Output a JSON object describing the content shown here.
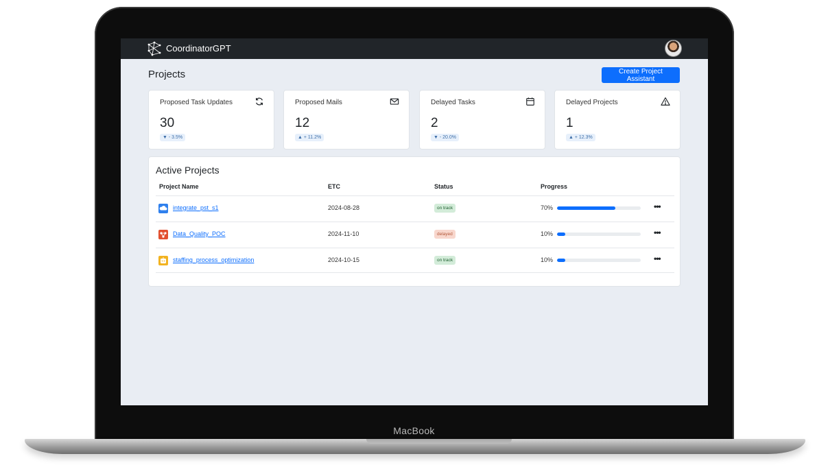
{
  "device": {
    "brand": "MacBook"
  },
  "navbar": {
    "app_title": "CoordinatorGPT"
  },
  "header": {
    "title": "Projects",
    "create_button": "Create Project Assistant"
  },
  "stats": [
    {
      "label": "Proposed Task Updates",
      "value": "30",
      "change": "▼ - 3.5%",
      "icon": "refresh-icon"
    },
    {
      "label": "Proposed Mails",
      "value": "12",
      "change": "▲ + 11.2%",
      "icon": "envelope-icon"
    },
    {
      "label": "Delayed Tasks",
      "value": "2",
      "change": "▼ - 20.0%",
      "icon": "calendar-icon"
    },
    {
      "label": "Delayed Projects",
      "value": "1",
      "change": "▲ + 12.3%",
      "icon": "warning-icon"
    }
  ],
  "active_projects": {
    "title": "Active Projects",
    "columns": [
      "Project Name",
      "ETC",
      "Status",
      "Progress"
    ],
    "rows": [
      {
        "name": "integrate_pst_s1",
        "etc": "2024-08-28",
        "status": "on track",
        "progress_label": "70%",
        "progress": 0.7,
        "icon": "cloud-project-icon",
        "icon_color": "#2f80ed",
        "status_color": "#d3ecd9"
      },
      {
        "name": "Data_Quality_POC",
        "etc": "2024-11-10",
        "status": "delayed",
        "progress_label": "10%",
        "progress": 0.1,
        "icon": "network-project-icon",
        "icon_color": "#e2502f",
        "status_color": "#f8d7cd"
      },
      {
        "name": "staffing_process_optimization",
        "etc": "2024-10-15",
        "status": "on track",
        "progress_label": "10%",
        "progress": 0.1,
        "icon": "bot-project-icon",
        "icon_color": "#f2b321",
        "status_color": "#d3ecd9"
      }
    ]
  },
  "colors": {
    "primary": "#0d6efd",
    "navbar": "#212529",
    "background": "#e9edf3"
  }
}
